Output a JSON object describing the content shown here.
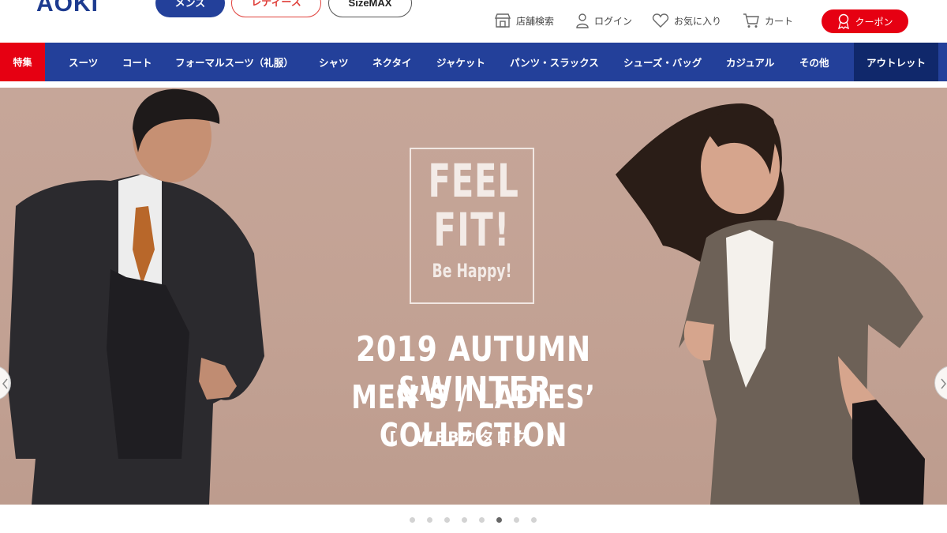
{
  "brand": {
    "logo_text": "AOKI",
    "color": "#1d3b8f"
  },
  "header": {
    "segments": [
      {
        "label": "メンズ"
      },
      {
        "label": "レディース"
      },
      {
        "label": "SizeMAX"
      }
    ],
    "utility": [
      {
        "label": "店舗検索",
        "icon": "store-icon"
      },
      {
        "label": "ログイン",
        "icon": "user-icon"
      },
      {
        "label": "お気に入り",
        "icon": "heart-icon"
      },
      {
        "label": "カート",
        "icon": "cart-icon"
      }
    ],
    "coupon_label": "クーポン"
  },
  "nav": {
    "feature": "特集",
    "items": [
      "スーツ",
      "コート",
      "フォーマルスーツ（礼服）",
      "シャツ",
      "ネクタイ",
      "ジャケット",
      "パンツ・スラックス",
      "シューズ・バッグ",
      "カジュアル",
      "その他"
    ],
    "outlet": "アウトレット"
  },
  "hero": {
    "feel_1": "FEEL",
    "feel_2": "FIT!",
    "feel_3": "Be Happy!",
    "line1": "2019 AUTUMN &WINTER",
    "line2": "MEN’S / LADIES’ COLLECTION",
    "cta": "[　WEBカタログ　]"
  },
  "carousel": {
    "total": 8,
    "active_index": 5
  },
  "colors": {
    "nav_blue": "#23409a",
    "outlet_navy": "#10286b",
    "accent_red": "#e60012",
    "hero_bg": "#c6a699"
  }
}
